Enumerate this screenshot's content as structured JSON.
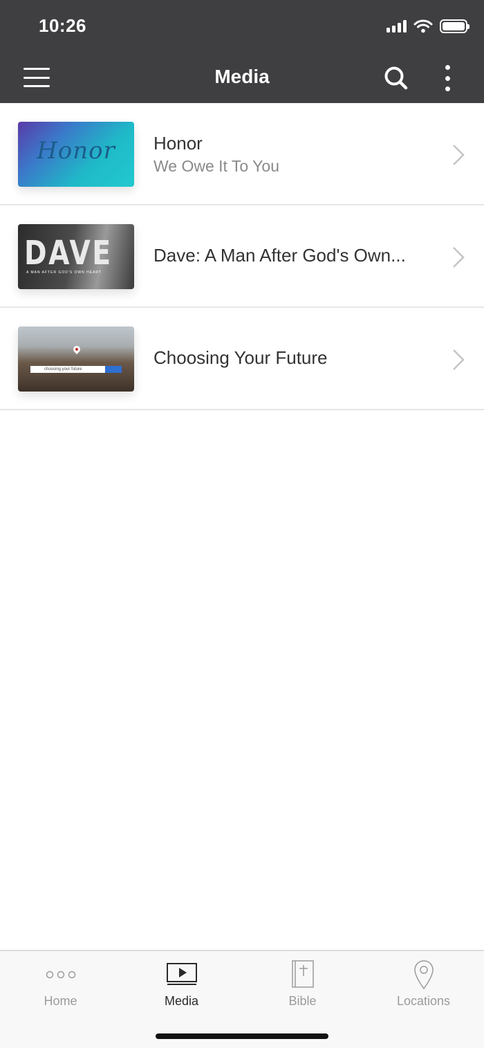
{
  "status_bar": {
    "time": "10:26"
  },
  "header": {
    "title": "Media"
  },
  "media_items": [
    {
      "title": "Honor",
      "subtitle": "We Owe It To You",
      "thumb_word": "Honor"
    },
    {
      "title": "Dave: A Man After God's Own...",
      "subtitle": "",
      "thumb_word": "DAVE",
      "thumb_tag": "A MAN AFTER GOD'S OWN HEART"
    },
    {
      "title": "Choosing Your Future",
      "subtitle": "",
      "thumb_search_text": "choosing your future"
    }
  ],
  "tabs": [
    {
      "label": "Home",
      "icon": "dots-icon",
      "active": false
    },
    {
      "label": "Media",
      "icon": "play-screen-icon",
      "active": true
    },
    {
      "label": "Bible",
      "icon": "bible-icon",
      "active": false
    },
    {
      "label": "Locations",
      "icon": "location-pin-icon",
      "active": false
    }
  ],
  "colors": {
    "header_bg": "#3f3f41",
    "text": "#333333",
    "subtle": "#8a8a8a",
    "tab_inactive": "#9b9b9b"
  }
}
